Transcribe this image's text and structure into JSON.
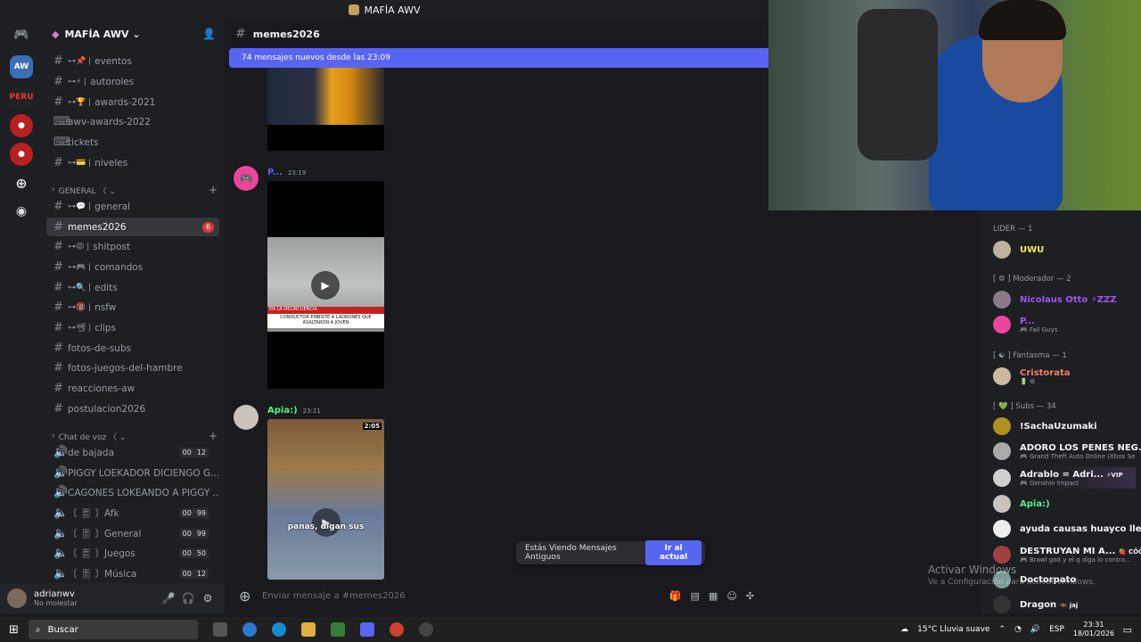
{
  "topbar": {
    "title": "MAFÍA AWV"
  },
  "server": {
    "name": "MAFÍA AWV ⌄"
  },
  "channels": [
    {
      "name": "eventos",
      "deco": "⊶📌 |"
    },
    {
      "name": "autoroles",
      "deco": "⊶⚡ |"
    },
    {
      "name": "awards-2021",
      "deco": "⊶🏆 |"
    },
    {
      "name": "awv-awards-2022",
      "deco": ""
    },
    {
      "name": "tickets",
      "deco": ""
    },
    {
      "name": "niveles",
      "deco": "⊶💳 |"
    }
  ],
  "category_general": "GENERAL 〈 ⌄",
  "general_channels": [
    {
      "name": "general",
      "deco": "⊶💬 |"
    },
    {
      "name": "memes2026",
      "deco": "",
      "badge": "6"
    },
    {
      "name": "shitpost",
      "deco": "⊶😡 |"
    },
    {
      "name": "comandos",
      "deco": "⊶🎮 |"
    },
    {
      "name": "edits",
      "deco": "⊶🔍 |"
    },
    {
      "name": "nsfw",
      "deco": "⊶🔞 |"
    },
    {
      "name": "clips",
      "deco": "⊶📽 |"
    },
    {
      "name": "fotos-de-subs",
      "deco": ""
    },
    {
      "name": "fotos-juegos-del-hambre",
      "deco": ""
    },
    {
      "name": "reacciones-aw",
      "deco": ""
    },
    {
      "name": "postulacion2026",
      "deco": ""
    }
  ],
  "category_voice": "Chat de voz 〈 ⌄",
  "voice_channels": [
    {
      "name": "de bajada",
      "cnt_a": "00",
      "cnt_b": "12"
    },
    {
      "name": "PIGGY LOEKADOR DICIENGO G...",
      "cnt_a": "",
      "cnt_b": ""
    },
    {
      "name": "CAGONES LOKEANDO A PIGGY ...",
      "cnt_a": "",
      "cnt_b": ""
    },
    {
      "name": "〔 🎚 〕Afk",
      "cnt_a": "00",
      "cnt_b": "99"
    },
    {
      "name": "〔 🎚 〕General",
      "cnt_a": "00",
      "cnt_b": "99"
    },
    {
      "name": "〔 🎚 〕Juegos",
      "cnt_a": "00",
      "cnt_b": "50"
    },
    {
      "name": "〔 🎚 〕Música",
      "cnt_a": "00",
      "cnt_b": "12"
    }
  ],
  "user": {
    "name": "adrianwv",
    "status": "No molestar"
  },
  "chat": {
    "channel": "memes2026",
    "new_messages": "74 mensajes nuevos desde las 23:09",
    "msg1_name": "P...",
    "msg1_time": "23:19",
    "msg2_name": "Apia:)",
    "msg2_time": "23:21",
    "video_caption": "CONDUCTOR EMBISTE A LADRONES QUE ASALTARON A JOVEN",
    "video_tag": "EN LA DELINCUENCIA",
    "game_time": "2:05",
    "game_sub": "panas, digan sus",
    "old_notice": "Estás Viendo Mensajes Antiguos",
    "jump_button": "Ir al actual",
    "composer_placeholder": "Enviar mensaje a #memes2026"
  },
  "members": {
    "g1": "LIDER — 1",
    "g2": "[ ⚙ ] Moderador — 2",
    "g3": "[ ☯ ] Fantasma — 1",
    "g4": "[ 💚 ] Subs — 34",
    "m1": "UWU",
    "m2": "Nicolaus Otto ⚡ZZZ",
    "m3": "P...",
    "m3_sub": "🎮 Fall Guys",
    "m4": "Cristorata",
    "m4_sub": "🔋 ⚙",
    "m5": "!SachaUzumaki",
    "m6": "ADORO LOS PENES NEG...",
    "m6_sub": "🎮 Grand Theft Auto Online (Xbox Se",
    "m7": "Adrablo = Adri...",
    "m7_badge": "⚡VIP",
    "m7_sub": "🎮 Genshin Impact",
    "m8": "Apia:)",
    "m9": "ayuda causas huayco llev...",
    "m10": "DESTRUYAN MI A...",
    "m10_badge": "🍓 CŌÖL",
    "m10_sub": "🎮 Brawl god y el q diga lo contra...",
    "m11": "Doctorpato",
    "m12": "Dragon",
    "m12_badge": "🦇 jaj"
  },
  "watermark": {
    "title": "Activar Windows",
    "sub": "Ve a Configuración para activar Windows."
  },
  "taskbar": {
    "search": "Buscar",
    "weather": "15°C  Lluvia suave",
    "lang": "ESP",
    "time": "23:31",
    "date": "18/01/2026"
  }
}
